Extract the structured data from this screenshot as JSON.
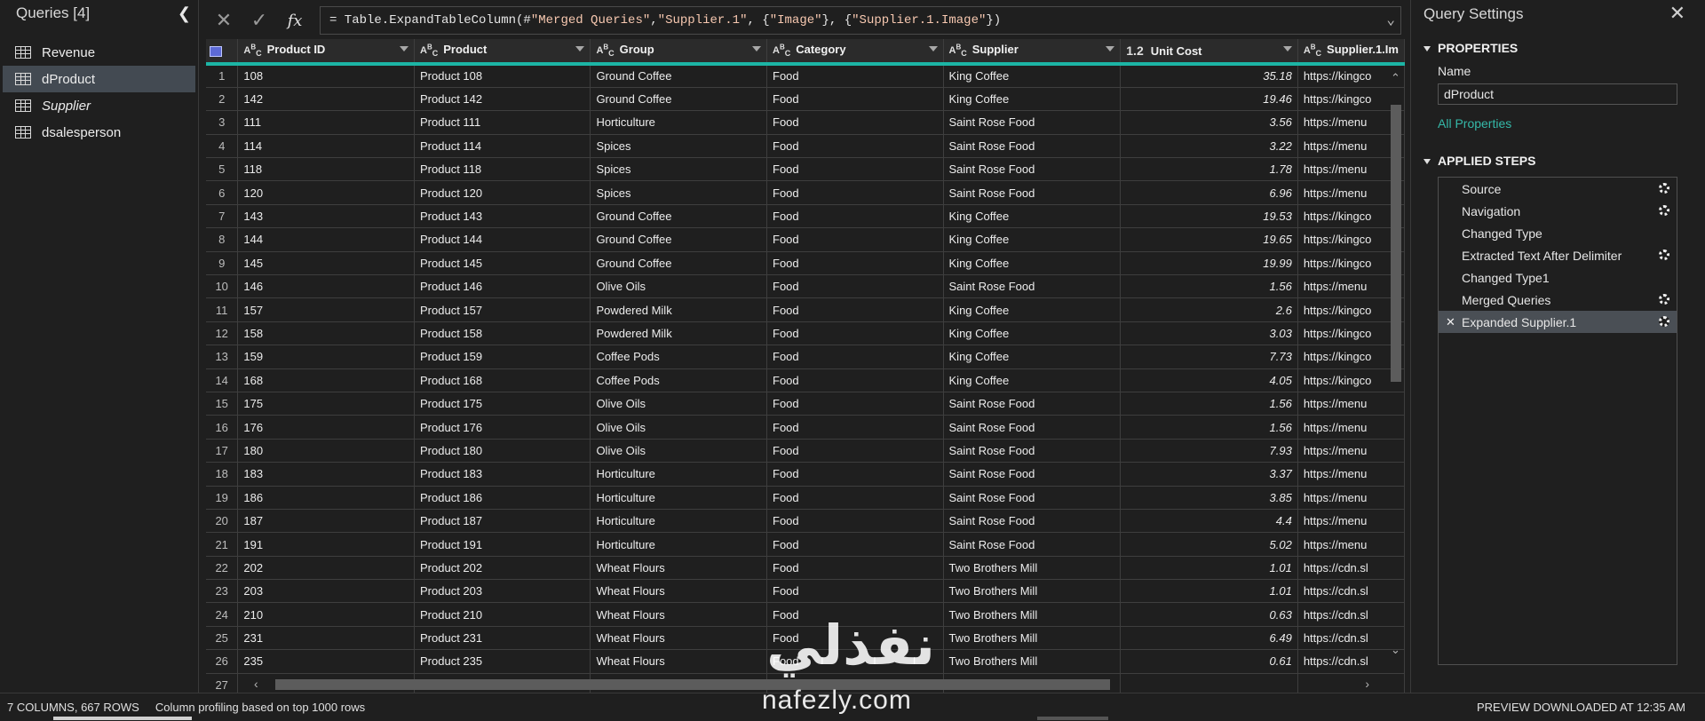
{
  "queries": {
    "header": "Queries [4]",
    "items": [
      {
        "label": "Revenue",
        "selected": false,
        "italic": false
      },
      {
        "label": "dProduct",
        "selected": true,
        "italic": false
      },
      {
        "label": "Supplier",
        "selected": false,
        "italic": true
      },
      {
        "label": "dsalesperson",
        "selected": false,
        "italic": false
      }
    ]
  },
  "formula": {
    "prefix": "= Table.ExpandTableColumn(#",
    "s1": "\"Merged Queries\"",
    "c1": ", ",
    "s2": "\"Supplier.1\"",
    "c2": ", {",
    "s3": "\"Image\"",
    "c3": "}, {",
    "s4": "\"Supplier.1.Image\"",
    "c4": "})"
  },
  "grid": {
    "columns": [
      {
        "type": "ABC",
        "label": "Product ID"
      },
      {
        "type": "ABC",
        "label": "Product"
      },
      {
        "type": "ABC",
        "label": "Group"
      },
      {
        "type": "ABC",
        "label": "Category"
      },
      {
        "type": "ABC",
        "label": "Supplier"
      },
      {
        "type": "1.2",
        "label": "Unit Cost"
      },
      {
        "type": "ABC",
        "label": "Supplier.1.Im"
      }
    ],
    "rows": [
      [
        "1",
        "108",
        "Product 108",
        "Ground Coffee",
        "Food",
        "King Coffee",
        "35.18",
        "https://kingco"
      ],
      [
        "2",
        "142",
        "Product 142",
        "Ground Coffee",
        "Food",
        "King Coffee",
        "19.46",
        "https://kingco"
      ],
      [
        "3",
        "111",
        "Product 111",
        "Horticulture",
        "Food",
        "Saint Rose Food",
        "3.56",
        "https://menu"
      ],
      [
        "4",
        "114",
        "Product 114",
        "Spices",
        "Food",
        "Saint Rose Food",
        "3.22",
        "https://menu"
      ],
      [
        "5",
        "118",
        "Product 118",
        "Spices",
        "Food",
        "Saint Rose Food",
        "1.78",
        "https://menu"
      ],
      [
        "6",
        "120",
        "Product 120",
        "Spices",
        "Food",
        "Saint Rose Food",
        "6.96",
        "https://menu"
      ],
      [
        "7",
        "143",
        "Product 143",
        "Ground Coffee",
        "Food",
        "King Coffee",
        "19.53",
        "https://kingco"
      ],
      [
        "8",
        "144",
        "Product 144",
        "Ground Coffee",
        "Food",
        "King Coffee",
        "19.65",
        "https://kingco"
      ],
      [
        "9",
        "145",
        "Product 145",
        "Ground Coffee",
        "Food",
        "King Coffee",
        "19.99",
        "https://kingco"
      ],
      [
        "10",
        "146",
        "Product 146",
        "Olive Oils",
        "Food",
        "Saint Rose Food",
        "1.56",
        "https://menu"
      ],
      [
        "11",
        "157",
        "Product 157",
        "Powdered Milk",
        "Food",
        "King Coffee",
        "2.6",
        "https://kingco"
      ],
      [
        "12",
        "158",
        "Product 158",
        "Powdered Milk",
        "Food",
        "King Coffee",
        "3.03",
        "https://kingco"
      ],
      [
        "13",
        "159",
        "Product 159",
        "Coffee Pods",
        "Food",
        "King Coffee",
        "7.73",
        "https://kingco"
      ],
      [
        "14",
        "168",
        "Product 168",
        "Coffee Pods",
        "Food",
        "King Coffee",
        "4.05",
        "https://kingco"
      ],
      [
        "15",
        "175",
        "Product 175",
        "Olive Oils",
        "Food",
        "Saint Rose Food",
        "1.56",
        "https://menu"
      ],
      [
        "16",
        "176",
        "Product 176",
        "Olive Oils",
        "Food",
        "Saint Rose Food",
        "1.56",
        "https://menu"
      ],
      [
        "17",
        "180",
        "Product 180",
        "Olive Oils",
        "Food",
        "Saint Rose Food",
        "7.93",
        "https://menu"
      ],
      [
        "18",
        "183",
        "Product 183",
        "Horticulture",
        "Food",
        "Saint Rose Food",
        "3.37",
        "https://menu"
      ],
      [
        "19",
        "186",
        "Product 186",
        "Horticulture",
        "Food",
        "Saint Rose Food",
        "3.85",
        "https://menu"
      ],
      [
        "20",
        "187",
        "Product 187",
        "Horticulture",
        "Food",
        "Saint Rose Food",
        "4.4",
        "https://menu"
      ],
      [
        "21",
        "191",
        "Product 191",
        "Horticulture",
        "Food",
        "Saint Rose Food",
        "5.02",
        "https://menu"
      ],
      [
        "22",
        "202",
        "Product 202",
        "Wheat Flours",
        "Food",
        "Two Brothers Mill",
        "1.01",
        "https://cdn.sl"
      ],
      [
        "23",
        "203",
        "Product 203",
        "Wheat Flours",
        "Food",
        "Two Brothers Mill",
        "1.01",
        "https://cdn.sl"
      ],
      [
        "24",
        "210",
        "Product 210",
        "Wheat Flours",
        "Food",
        "Two Brothers Mill",
        "0.63",
        "https://cdn.sl"
      ],
      [
        "25",
        "231",
        "Product 231",
        "Wheat Flours",
        "Food",
        "Two Brothers Mill",
        "6.49",
        "https://cdn.sl"
      ],
      [
        "26",
        "235",
        "Product 235",
        "Wheat Flours",
        "Food",
        "Two Brothers Mill",
        "0.61",
        "https://cdn.sl"
      ],
      [
        "27",
        "",
        "",
        "",
        "",
        "",
        "",
        ""
      ]
    ]
  },
  "settings": {
    "title": "Query Settings",
    "properties_head": "PROPERTIES",
    "name_label": "Name",
    "name_value": "dProduct",
    "all_properties": "All Properties",
    "steps_head": "APPLIED STEPS",
    "steps": [
      {
        "label": "Source",
        "gear": true,
        "selected": false
      },
      {
        "label": "Navigation",
        "gear": true,
        "selected": false
      },
      {
        "label": "Changed Type",
        "gear": false,
        "selected": false
      },
      {
        "label": "Extracted Text After Delimiter",
        "gear": true,
        "selected": false
      },
      {
        "label": "Changed Type1",
        "gear": false,
        "selected": false
      },
      {
        "label": "Merged Queries",
        "gear": true,
        "selected": false
      },
      {
        "label": "Expanded Supplier.1",
        "gear": true,
        "selected": true
      }
    ]
  },
  "status": {
    "columns_rows": "7 COLUMNS, 667 ROWS",
    "profiling": "Column profiling based on top 1000 rows",
    "preview": "PREVIEW DOWNLOADED AT 12:35 AM"
  },
  "watermark": {
    "arabic": "نفذلي",
    "latin": "nafezly.com"
  },
  "colors": {
    "accent_teal": "#1cb5a5",
    "link_teal": "#35b8a8",
    "background": "#1f1f1f"
  }
}
